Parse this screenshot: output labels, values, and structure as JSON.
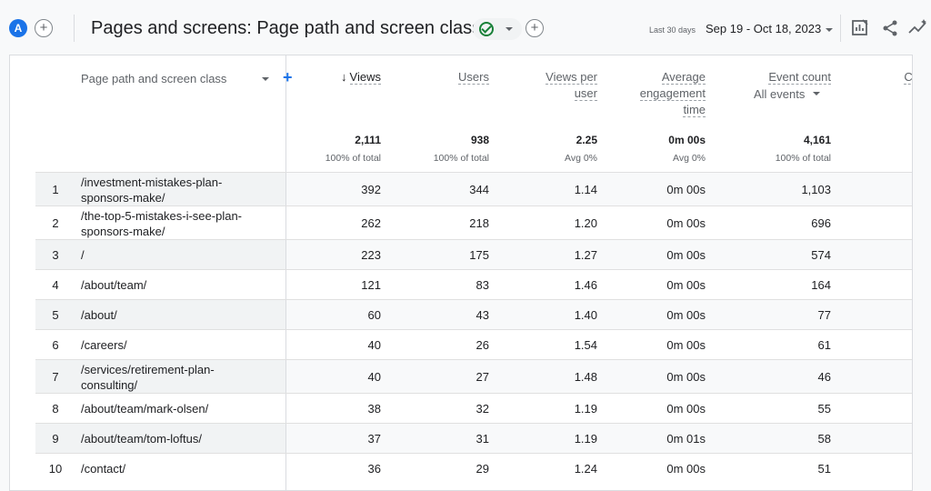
{
  "header": {
    "avatar_letter": "A",
    "add_symbol": "+",
    "title": "Pages and screens: Page path and screen class",
    "date_label": "Last 30 days",
    "date_range": "Sep 19 - Oct 18, 2023"
  },
  "table": {
    "dimension_label": "Page path and screen class",
    "add_dimension": "+",
    "columns": [
      {
        "label_lines": [
          "Views"
        ],
        "sorted": true,
        "sub": ""
      },
      {
        "label_lines": [
          "Users"
        ],
        "sorted": false,
        "sub": ""
      },
      {
        "label_lines": [
          "Views per",
          "user"
        ],
        "sorted": false,
        "sub": ""
      },
      {
        "label_lines": [
          "Average",
          "engagement",
          "time"
        ],
        "sorted": false,
        "sub": ""
      },
      {
        "label_lines": [
          "Event count"
        ],
        "sorted": false,
        "sub": "All events"
      },
      {
        "label_lines": [
          "Co"
        ],
        "sorted": false,
        "sub": "All e"
      }
    ],
    "totals": [
      {
        "value": "2,111",
        "sub": "100% of total"
      },
      {
        "value": "938",
        "sub": "100% of total"
      },
      {
        "value": "2.25",
        "sub": "Avg 0%"
      },
      {
        "value": "0m 00s",
        "sub": "Avg 0%"
      },
      {
        "value": "4,161",
        "sub": "100% of total"
      }
    ],
    "rows": [
      {
        "n": "1",
        "path": "/investment-mistakes-plan-sponsors-make/",
        "views": "392",
        "users": "344",
        "vpu": "1.14",
        "aet": "0m 00s",
        "events": "1,103"
      },
      {
        "n": "2",
        "path": "/the-top-5-mistakes-i-see-plan-sponsors-make/",
        "views": "262",
        "users": "218",
        "vpu": "1.20",
        "aet": "0m 00s",
        "events": "696"
      },
      {
        "n": "3",
        "path": "/",
        "views": "223",
        "users": "175",
        "vpu": "1.27",
        "aet": "0m 00s",
        "events": "574"
      },
      {
        "n": "4",
        "path": "/about/team/",
        "views": "121",
        "users": "83",
        "vpu": "1.46",
        "aet": "0m 00s",
        "events": "164"
      },
      {
        "n": "5",
        "path": "/about/",
        "views": "60",
        "users": "43",
        "vpu": "1.40",
        "aet": "0m 00s",
        "events": "77"
      },
      {
        "n": "6",
        "path": "/careers/",
        "views": "40",
        "users": "26",
        "vpu": "1.54",
        "aet": "0m 00s",
        "events": "61"
      },
      {
        "n": "7",
        "path": "/services/retirement-plan-consulting/",
        "views": "40",
        "users": "27",
        "vpu": "1.48",
        "aet": "0m 00s",
        "events": "46"
      },
      {
        "n": "8",
        "path": "/about/team/mark-olsen/",
        "views": "38",
        "users": "32",
        "vpu": "1.19",
        "aet": "0m 00s",
        "events": "55"
      },
      {
        "n": "9",
        "path": "/about/team/tom-loftus/",
        "views": "37",
        "users": "31",
        "vpu": "1.19",
        "aet": "0m 01s",
        "events": "58"
      },
      {
        "n": "10",
        "path": "/contact/",
        "views": "36",
        "users": "29",
        "vpu": "1.24",
        "aet": "0m 00s",
        "events": "51"
      }
    ]
  },
  "icons": [
    "customize-report-icon",
    "share-icon",
    "insights-icon",
    "check-circle-icon",
    "sort-down-arrow-icon"
  ],
  "colors": {
    "accent": "#1a73e8",
    "success": "#188038"
  }
}
